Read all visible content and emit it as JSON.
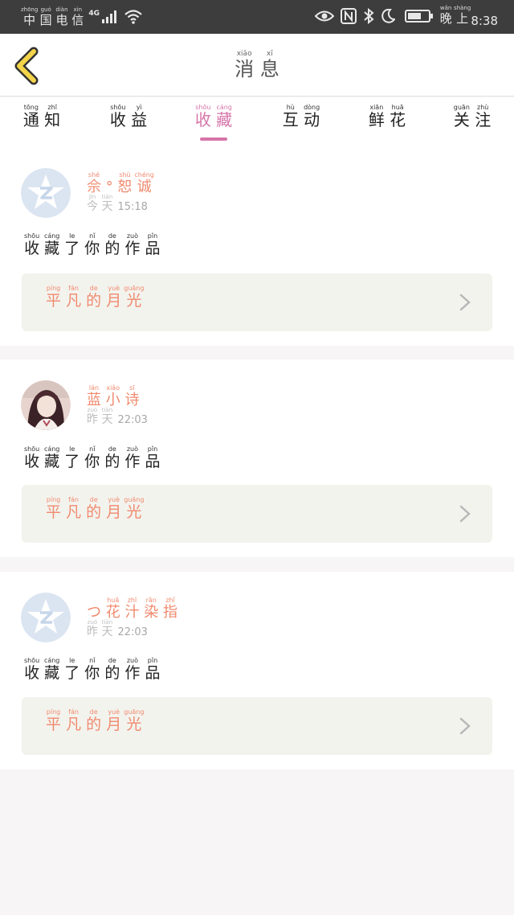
{
  "status_bar": {
    "carrier": [
      {
        "char": "中",
        "py": "zhōng"
      },
      {
        "char": "国",
        "py": "guó"
      },
      {
        "char": "电",
        "py": "diàn"
      },
      {
        "char": "信",
        "py": "xìn"
      }
    ],
    "network": "4G",
    "time_label": [
      {
        "char": "晚",
        "py": "wǎn"
      },
      {
        "char": "上",
        "py": "shàng"
      }
    ],
    "time": "8:38"
  },
  "header": {
    "title": [
      {
        "char": "消",
        "py": "xiāo"
      },
      {
        "char": "息",
        "py": "xī"
      }
    ]
  },
  "tabs": [
    {
      "chars": [
        {
          "char": "通",
          "py": "tōng"
        },
        {
          "char": "知",
          "py": "zhī"
        }
      ],
      "active": false
    },
    {
      "chars": [
        {
          "char": "收",
          "py": "shōu"
        },
        {
          "char": "益",
          "py": "yì"
        }
      ],
      "active": false
    },
    {
      "chars": [
        {
          "char": "收",
          "py": "shōu"
        },
        {
          "char": "藏",
          "py": "cáng"
        }
      ],
      "active": true
    },
    {
      "chars": [
        {
          "char": "互",
          "py": "hù"
        },
        {
          "char": "动",
          "py": "dòng"
        }
      ],
      "active": false
    },
    {
      "chars": [
        {
          "char": "鲜",
          "py": "xiān"
        },
        {
          "char": "花",
          "py": "huā"
        }
      ],
      "active": false
    },
    {
      "chars": [
        {
          "char": "关",
          "py": "guān"
        },
        {
          "char": "注",
          "py": "zhù"
        }
      ],
      "active": false
    }
  ],
  "messages": [
    {
      "avatar": "default-qq-icon",
      "username": [
        {
          "char": "佘",
          "py": "shé"
        },
        {
          "char": "°",
          "py": ""
        },
        {
          "char": "恕",
          "py": "shù"
        },
        {
          "char": "诚",
          "py": "chéng"
        }
      ],
      "day": [
        {
          "char": "今",
          "py": "jīn"
        },
        {
          "char": "天",
          "py": "tiān"
        }
      ],
      "clock": "15:18",
      "action": [
        {
          "char": "收",
          "py": "shōu"
        },
        {
          "char": "藏",
          "py": "cáng"
        },
        {
          "char": "了",
          "py": "le"
        },
        {
          "char": "你",
          "py": "nǐ"
        },
        {
          "char": "的",
          "py": "de"
        },
        {
          "char": "作",
          "py": "zuò"
        },
        {
          "char": "品",
          "py": "pǐn"
        }
      ],
      "work_title": [
        {
          "char": "平",
          "py": "píng"
        },
        {
          "char": "凡",
          "py": "fán"
        },
        {
          "char": "的",
          "py": "de"
        },
        {
          "char": "月",
          "py": "yuè"
        },
        {
          "char": "光",
          "py": "guāng"
        }
      ]
    },
    {
      "avatar": "user-photo",
      "username": [
        {
          "char": "蓝",
          "py": "lán"
        },
        {
          "char": "小",
          "py": "xiǎo"
        },
        {
          "char": "诗",
          "py": "sī"
        }
      ],
      "day": [
        {
          "char": "昨",
          "py": "zuó"
        },
        {
          "char": "天",
          "py": "tiān"
        }
      ],
      "clock": "22:03",
      "action": [
        {
          "char": "收",
          "py": "shōu"
        },
        {
          "char": "藏",
          "py": "cáng"
        },
        {
          "char": "了",
          "py": "le"
        },
        {
          "char": "你",
          "py": "nǐ"
        },
        {
          "char": "的",
          "py": "de"
        },
        {
          "char": "作",
          "py": "zuò"
        },
        {
          "char": "品",
          "py": "pǐn"
        }
      ],
      "work_title": [
        {
          "char": "平",
          "py": "píng"
        },
        {
          "char": "凡",
          "py": "fán"
        },
        {
          "char": "的",
          "py": "de"
        },
        {
          "char": "月",
          "py": "yuè"
        },
        {
          "char": "光",
          "py": "guāng"
        }
      ]
    },
    {
      "avatar": "default-qq-icon",
      "username": [
        {
          "char": "つ",
          "py": ""
        },
        {
          "char": "花",
          "py": "huā"
        },
        {
          "char": "汁",
          "py": "zhī"
        },
        {
          "char": "染",
          "py": "rǎn"
        },
        {
          "char": "指",
          "py": "zhǐ"
        }
      ],
      "day": [
        {
          "char": "昨",
          "py": "zuó"
        },
        {
          "char": "天",
          "py": "tiān"
        }
      ],
      "clock": "22:03",
      "action": [
        {
          "char": "收",
          "py": "shōu"
        },
        {
          "char": "藏",
          "py": "cáng"
        },
        {
          "char": "了",
          "py": "le"
        },
        {
          "char": "你",
          "py": "nǐ"
        },
        {
          "char": "的",
          "py": "de"
        },
        {
          "char": "作",
          "py": "zuò"
        },
        {
          "char": "品",
          "py": "pǐn"
        }
      ],
      "work_title": [
        {
          "char": "平",
          "py": "píng"
        },
        {
          "char": "凡",
          "py": "fán"
        },
        {
          "char": "的",
          "py": "de"
        },
        {
          "char": "月",
          "py": "yuè"
        },
        {
          "char": "光",
          "py": "guāng"
        }
      ]
    }
  ],
  "colors": {
    "accent_pink": "#d674a8",
    "name_orange": "#f08a6e",
    "back_arrow": "#f3d44a",
    "status_bar_bg": "#3d3d3d"
  }
}
